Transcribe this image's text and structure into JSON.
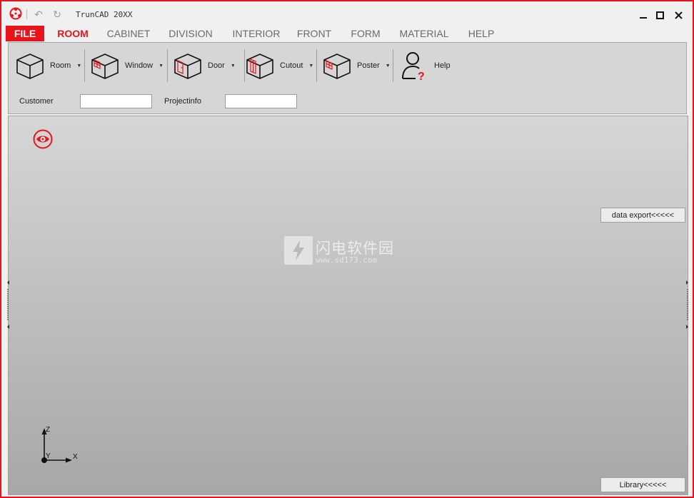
{
  "window": {
    "title": "TrunCAD 20XX",
    "accent": "#e8141c"
  },
  "quick_access": {
    "undo_icon": "undo-icon",
    "redo_icon": "redo-icon"
  },
  "menu": {
    "items": [
      {
        "label": "FILE"
      },
      {
        "label": "ROOM"
      },
      {
        "label": "CABINET"
      },
      {
        "label": "DIVISION"
      },
      {
        "label": "INTERIOR"
      },
      {
        "label": "FRONT"
      },
      {
        "label": "FORM"
      },
      {
        "label": "MATERIAL"
      },
      {
        "label": "HELP"
      }
    ],
    "active": "ROOM"
  },
  "ribbon": {
    "buttons": [
      {
        "label": "Room",
        "icon": "room-icon"
      },
      {
        "label": "Window",
        "icon": "window-icon"
      },
      {
        "label": "Door",
        "icon": "door-icon"
      },
      {
        "label": "Cutout",
        "icon": "cutout-icon"
      },
      {
        "label": "Poster",
        "icon": "poster-icon"
      },
      {
        "label": "Help",
        "icon": "help-icon"
      }
    ],
    "fields": {
      "customer_label": "Customer",
      "customer_value": "",
      "projectinfo_label": "Projectinfo",
      "projectinfo_value": ""
    }
  },
  "viewport": {
    "data_export_label": "data export<<<<<",
    "library_label": "Library<<<<<",
    "axes": {
      "z": "Z",
      "y": "Y",
      "x": "X"
    },
    "watermark": {
      "text": "闪电软件园",
      "url": "www.sd173.com"
    }
  }
}
